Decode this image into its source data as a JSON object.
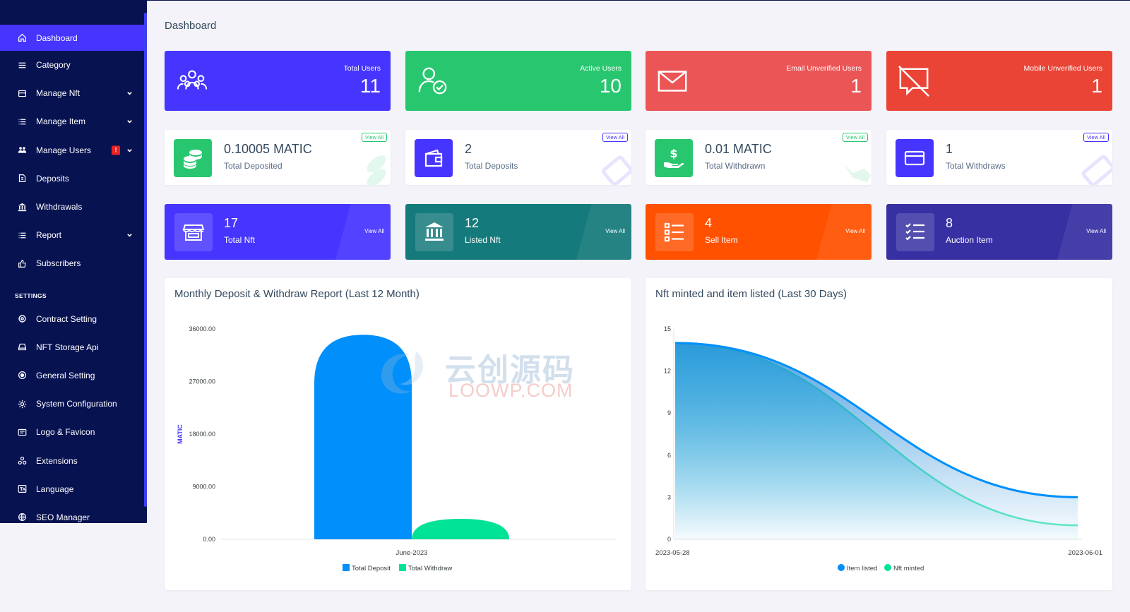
{
  "sidebar": {
    "items": [
      {
        "label": "Dashboard",
        "icon": "home-icon"
      },
      {
        "label": "Category",
        "icon": "menu-icon"
      },
      {
        "label": "Manage Nft",
        "icon": "layers-icon"
      },
      {
        "label": "Manage Item",
        "icon": "list-icon"
      },
      {
        "label": "Manage Users",
        "icon": "users-icon",
        "badge": "!"
      },
      {
        "label": "Deposits",
        "icon": "file-dollar-icon"
      },
      {
        "label": "Withdrawals",
        "icon": "bank-icon"
      },
      {
        "label": "Report",
        "icon": "list-icon"
      },
      {
        "label": "Subscribers",
        "icon": "thumbs-up-icon"
      }
    ],
    "section_label": "SETTINGS",
    "settings_items": [
      {
        "label": "Contract Setting",
        "icon": "life-ring-icon"
      },
      {
        "label": "NFT Storage Api",
        "icon": "drive-icon"
      },
      {
        "label": "General Setting",
        "icon": "target-icon"
      },
      {
        "label": "System Configuration",
        "icon": "cog-icon"
      },
      {
        "label": "Logo & Favicon",
        "icon": "images-icon"
      },
      {
        "label": "Extensions",
        "icon": "cogs-icon"
      },
      {
        "label": "Language",
        "icon": "language-icon"
      },
      {
        "label": "SEO Manager",
        "icon": "globe-icon"
      }
    ]
  },
  "page": {
    "title": "Dashboard"
  },
  "stats_row1": [
    {
      "label": "Total Users",
      "value": "11",
      "color": "#4634ff"
    },
    {
      "label": "Active Users",
      "value": "10",
      "color": "#28c76f"
    },
    {
      "label": "Email Unverified Users",
      "value": "1",
      "color": "#eb5555"
    },
    {
      "label": "Mobile Unverified Users",
      "value": "1",
      "color": "#ea4436"
    }
  ],
  "stats_row2": [
    {
      "value": "0.10005 MATIC",
      "label": "Total Deposited",
      "view": "View All",
      "color": "#28c76f"
    },
    {
      "value": "2",
      "label": "Total Deposits",
      "view": "View All",
      "color": "#4634ff"
    },
    {
      "value": "0.01 MATIC",
      "label": "Total Withdrawn",
      "view": "View All",
      "color": "#28c76f"
    },
    {
      "value": "1",
      "label": "Total Withdraws",
      "view": "View All",
      "color": "#4634ff"
    }
  ],
  "stats_row3": [
    {
      "value": "17",
      "label": "Total Nft",
      "view": "View All",
      "color": "#4634ff"
    },
    {
      "value": "12",
      "label": "Listed Nft",
      "view": "View All",
      "color": "#157a7b"
    },
    {
      "value": "4",
      "label": "Sell Item",
      "view": "View All",
      "color": "#ff5100"
    },
    {
      "value": "8",
      "label": "Auction Item",
      "view": "View All",
      "color": "#3730a3"
    }
  ],
  "watermark": {
    "cn": "云创源码",
    "en": "LOOWP.COM"
  },
  "chart_data": [
    {
      "type": "bar",
      "title": "Monthly Deposit & Withdraw Report (Last 12 Month)",
      "categories": [
        "June-2023"
      ],
      "series": [
        {
          "name": "Total Deposit",
          "values": [
            35000
          ],
          "color": "#008ffb"
        },
        {
          "name": "Total Withdraw",
          "values": [
            3500
          ],
          "color": "#00e396"
        }
      ],
      "ylabel": "MATIC",
      "ylim": [
        0,
        36000
      ],
      "yticks": [
        "36000.00",
        "27000.00",
        "18000.00",
        "9000.00",
        "0.00"
      ],
      "legend": "bottom-center"
    },
    {
      "type": "area",
      "title": "Nft minted and item listed (Last 30 Days)",
      "x": [
        "2023-05-28",
        "2023-06-01"
      ],
      "series": [
        {
          "name": "Item listed",
          "values": [
            14,
            3
          ],
          "color": "#008ffb"
        },
        {
          "name": "Nft minted",
          "values": [
            14,
            1
          ],
          "color": "#00e396"
        }
      ],
      "ylim": [
        0,
        15
      ],
      "yticks": [
        "15",
        "12",
        "9",
        "6",
        "3",
        "0"
      ],
      "legend": "bottom-center"
    }
  ]
}
